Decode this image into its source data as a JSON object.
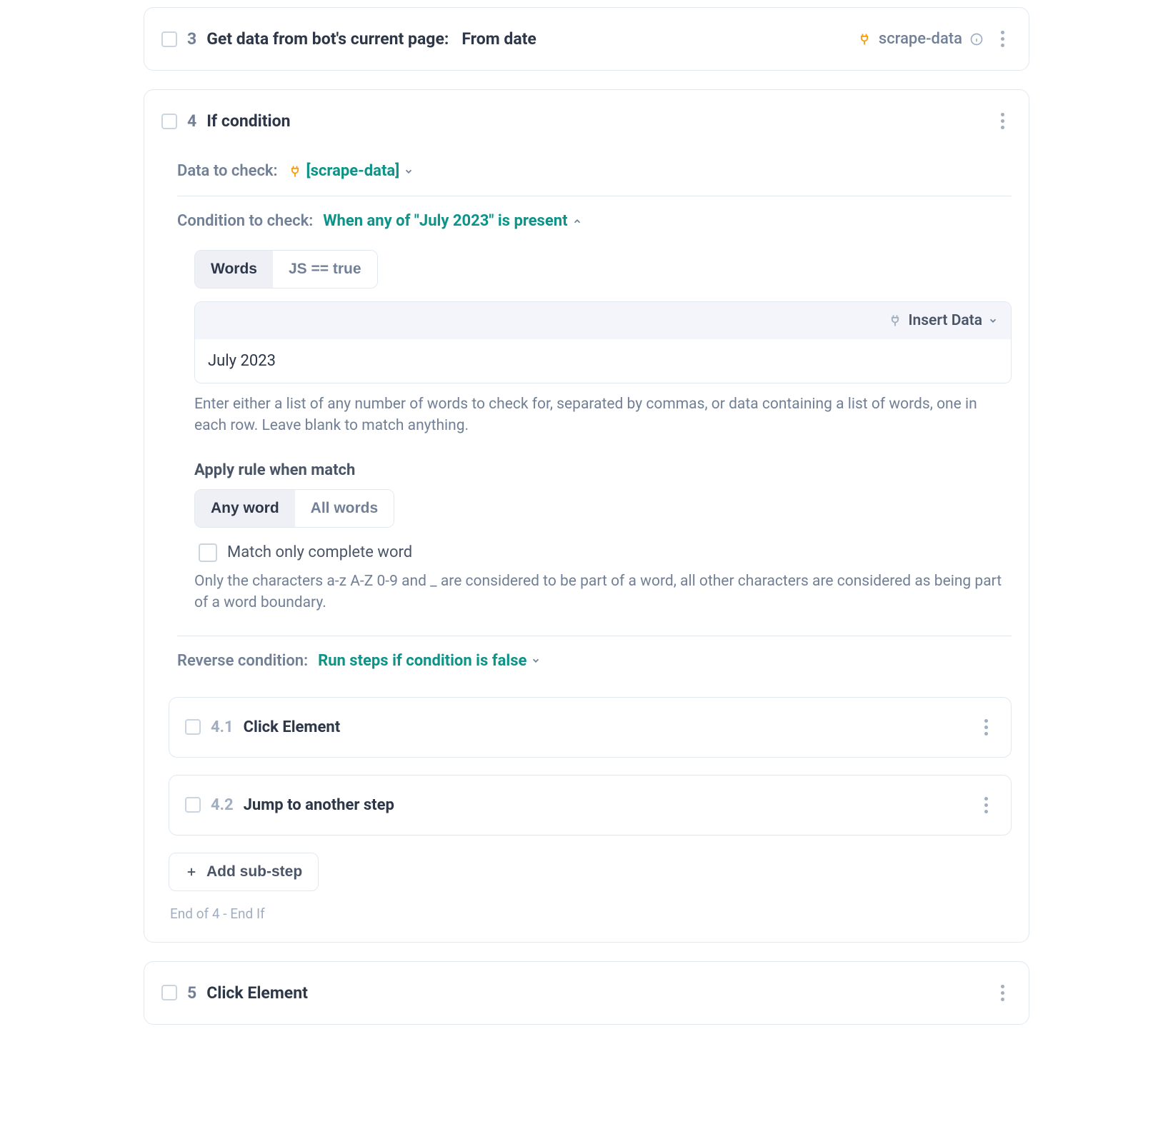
{
  "step3": {
    "num": "3",
    "title": "Get data from bot's current page:",
    "suffix": "From date",
    "tag": "scrape-data"
  },
  "step4": {
    "num": "4",
    "title": "If condition",
    "data_to_check_label": "Data to check:",
    "data_to_check_value": "[scrape-data]",
    "condition_label": "Condition to check:",
    "condition_value": "When any of \"July 2023\" is present",
    "tabs": {
      "words": "Words",
      "js": "JS == true"
    },
    "insert_data": "Insert Data",
    "words_value": "July 2023",
    "words_help": "Enter either a list of any number of words to check for, separated by commas, or data containing a list of words, one in each row. Leave blank to match anything.",
    "apply_rule_heading": "Apply rule when match",
    "match_tabs": {
      "any": "Any word",
      "all": "All words"
    },
    "match_complete": "Match only complete word",
    "match_complete_help": "Only the characters a-z A-Z 0-9 and _ are considered to be part of a word, all other characters are considered as being part of a word boundary.",
    "reverse_label": "Reverse condition:",
    "reverse_value": "Run steps if condition is false",
    "sub1": {
      "num": "4.1",
      "title": "Click Element"
    },
    "sub2": {
      "num": "4.2",
      "title": "Jump to another step"
    },
    "add_substep": "Add sub-step",
    "endnote": "End of 4 - End If"
  },
  "step5": {
    "num": "5",
    "title": "Click Element"
  }
}
